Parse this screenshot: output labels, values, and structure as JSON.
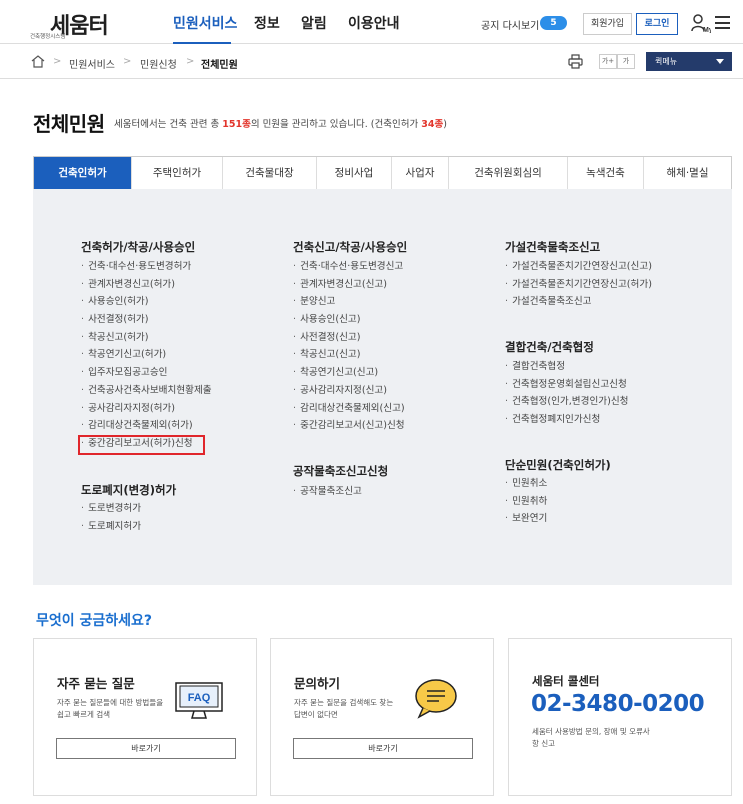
{
  "header": {
    "logo_name": "세움터",
    "logo_sub": "건축행정시스템",
    "nav": [
      "민원서비스",
      "정보",
      "알림",
      "이용안내"
    ],
    "notice_label": "공지 다시보기",
    "notice_count": "5",
    "join_label": "회원가입",
    "login_label": "로그인"
  },
  "breadcrumb": {
    "items": [
      "민원서비스",
      "민원신청",
      "전체민원"
    ],
    "font_plus": "가+",
    "font_minus": "가",
    "quick_menu": "퀵메뉴"
  },
  "title": {
    "heading": "전체민원",
    "desc_prefix": "세움터에서는 건축 관련 총 ",
    "total_count": "151종",
    "desc_middle": "의 민원을 관리하고 있습니다. (건축인허가 ",
    "category_count": "34종",
    "desc_suffix": ")"
  },
  "tabs": [
    "건축인허가",
    "주택인허가",
    "건축물대장",
    "정비사업",
    "사업자",
    "건축위원회심의",
    "녹색건축",
    "해체·멸실"
  ],
  "columns": {
    "col1": {
      "group1_title": "건축허가/착공/사용승인",
      "group1_items": [
        "건축·대수선·용도변경허가",
        "관계자변경신고(허가)",
        "사용승인(허가)",
        "사전결정(허가)",
        "착공신고(허가)",
        "착공연기신고(허가)",
        "입주자모집공고승인",
        "건축공사건축사보배치현황제출",
        "공사감리자지정(허가)",
        "감리대상건축물제외(허가)",
        "중간감리보고서(허가)신청"
      ],
      "group2_title": "도로폐지(변경)허가",
      "group2_items": [
        "도로변경허가",
        "도로폐지허가"
      ]
    },
    "col2": {
      "group1_title": "건축신고/착공/사용승인",
      "group1_items": [
        "건축·대수선·용도변경신고",
        "관계자변경신고(신고)",
        "분양신고",
        "사용승인(신고)",
        "사전결정(신고)",
        "착공신고(신고)",
        "착공연기신고(신고)",
        "공사감리자지정(신고)",
        "감리대상건축물제외(신고)",
        "중간감리보고서(신고)신청"
      ],
      "group2_title": "공작물축조신고신청",
      "group2_items": [
        "공작물축조신고"
      ]
    },
    "col3": {
      "group1_title": "가설건축물축조신고",
      "group1_items": [
        "가설건축물존치기간연장신고(신고)",
        "가설건축물존치기간연장신고(허가)",
        "가설건축물축조신고"
      ],
      "group2_title": "결합건축/건축협정",
      "group2_items": [
        "결합건축협정",
        "건축협정운영회설립신고신청",
        "건축협정(인가,변경인가)신청",
        "건축협정폐지인가신청"
      ],
      "group3_title": "단순민원(건축인허가)",
      "group3_items": [
        "민원취소",
        "민원취하",
        "보완연기"
      ]
    }
  },
  "help": {
    "section_title": "무엇이 궁금하세요?",
    "faq": {
      "title": "자주 묻는 질문",
      "desc": "자주 묻는 질문들에 대한 방법들을 쉽고 빠르게 검색",
      "icon_text": "FAQ",
      "button": "바로가기"
    },
    "inquiry": {
      "title": "문의하기",
      "desc": "자주 묻는 질문을 검색해도 찾는 답변이 없다면",
      "button": "바로가기"
    },
    "callcenter": {
      "title": "세움터 콜센터",
      "phone": "02-3480-0200",
      "desc": "세움터 사용방법 문의, 장애 및 오류사항 신고"
    }
  },
  "colors": {
    "primary": "#1b5fbd",
    "highlight": "#e0262b",
    "panel_bg": "#eef0f3",
    "badge": "#2c8ee8",
    "quick_menu_bg": "#243b6b"
  }
}
